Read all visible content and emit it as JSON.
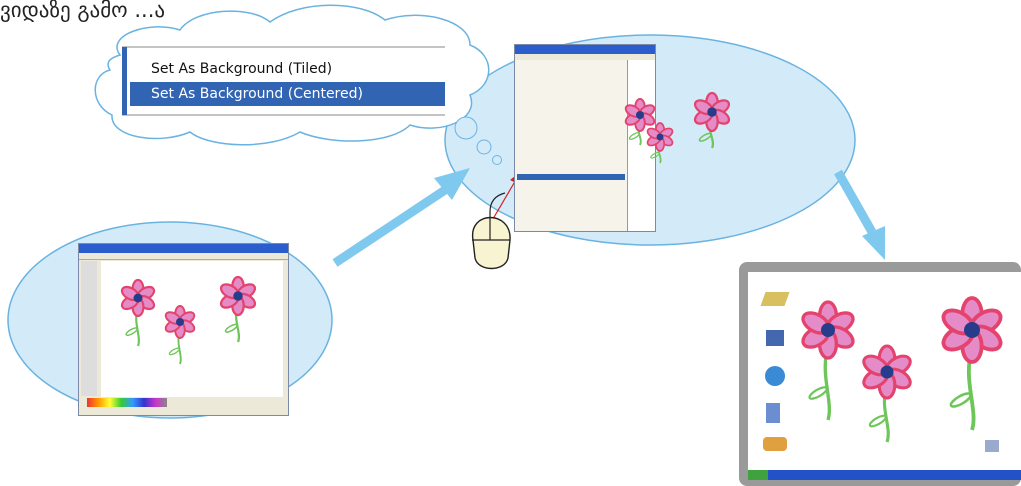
{
  "heading": "ვიდაზე გამო ...ა",
  "bubble_menu": {
    "items": [
      {
        "label": "Set As Background (Tiled)",
        "selected": false
      },
      {
        "label": "Set As Background (Centered)",
        "selected": true
      }
    ]
  },
  "colors": {
    "ellipse_fill": "#d3ebf9",
    "ellipse_stroke": "#6ab3e1",
    "arrow": "#7fc9ef",
    "menu_highlight": "#3264b4",
    "monitor_frame": "#9a9a9a",
    "taskbar": "#2352c8",
    "petal": "#e3436c",
    "petal_inner": "#e58cc8",
    "flower_center": "#283c8c",
    "stem": "#6ec55a",
    "mouse_body": "#f8f3d0",
    "pointer_line": "#d62020"
  },
  "icons": {
    "mouse": "mouse-icon",
    "pointer": "pointer-arrow-icon",
    "desktop": [
      "folder-icon",
      "my-computer-icon",
      "internet-explorer-icon",
      "recycle-bin-icon",
      "network-icon",
      "tray-icon"
    ]
  }
}
